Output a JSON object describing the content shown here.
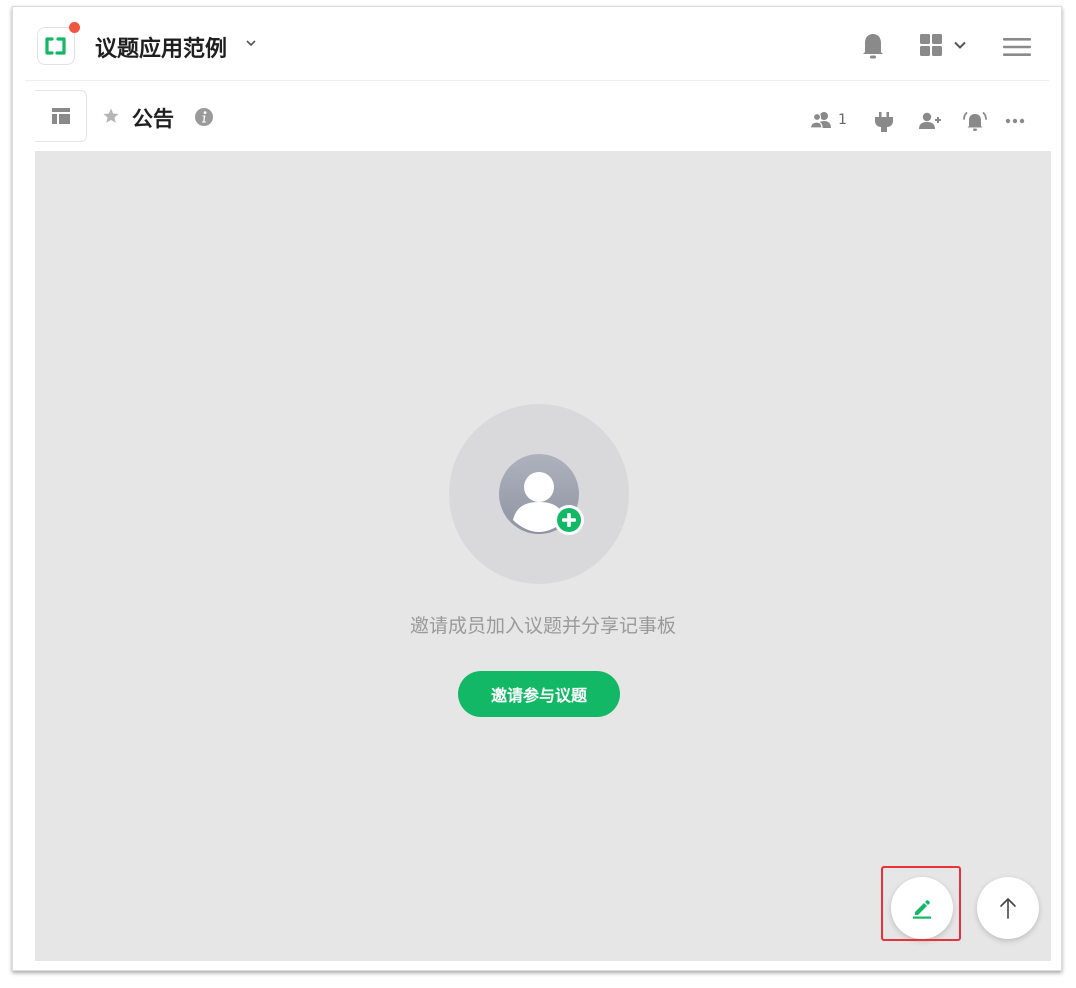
{
  "header": {
    "app_title": "议题应用范例",
    "logo_icon": "app-logo-icon",
    "notification_color": "#f0553f"
  },
  "board": {
    "title": "公告",
    "member_count": "1"
  },
  "empty_state": {
    "message": "邀请成员加入议题并分享记事板",
    "invite_button_label": "邀请参与议题"
  },
  "colors": {
    "accent": "#12b865",
    "content_bg": "#e6e6e6",
    "highlight": "#e8313a"
  }
}
